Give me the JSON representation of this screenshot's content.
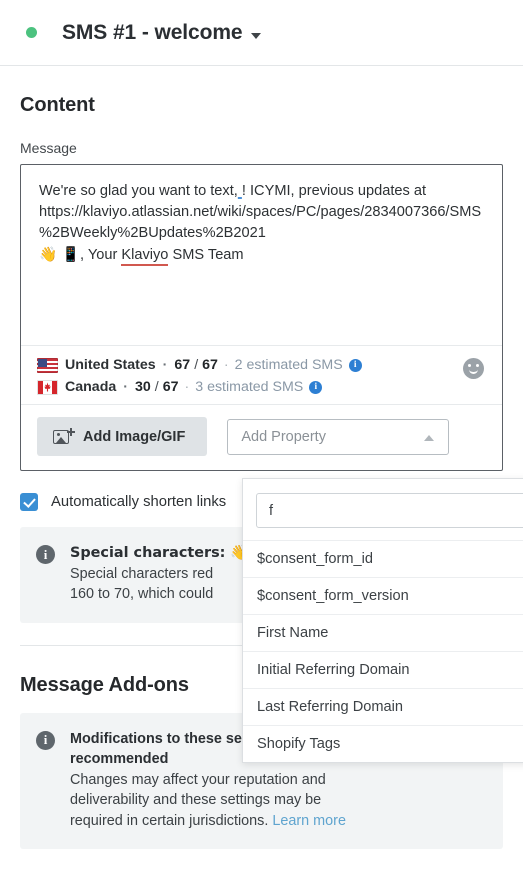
{
  "header": {
    "status_dot_color": "#4cc27f",
    "title": "SMS #1 - welcome",
    "caret_icon": "chevron-down-icon"
  },
  "content": {
    "section_title": "Content",
    "message_label": "Message",
    "message_parts": {
      "line1_a": "We're so glad you want to text,",
      "line1_err": " ",
      "line1_b": "! ICYMI, previous updates at",
      "line2": "https://klaviyo.atlassian.net/wiki/spaces/PC/pages/2834007366/SMS%2BWeekly%2BUpdates%2B2021",
      "line3_emoji": "👋 📱",
      "line3_a": ", Your ",
      "line3_sp": "Klaviyo",
      "line3_b": " SMS Team"
    },
    "counters": [
      {
        "country": "United States",
        "flag": "us-flag-icon",
        "used": "67",
        "slash": "/",
        "limit": "67",
        "estimate": "2 estimated SMS",
        "info_icon": "info-icon"
      },
      {
        "country": "Canada",
        "flag": "ca-flag-icon",
        "used": "30",
        "slash": "/",
        "limit": "67",
        "estimate": "3 estimated SMS",
        "info_icon": "info-icon"
      }
    ],
    "emoji_button_icon": "smiley-icon",
    "add_image_label": "Add Image/GIF",
    "add_image_icon": "image-plus-icon",
    "add_property_placeholder": "Add Property",
    "add_property_caret_icon": "chevron-up-icon",
    "shorten_links_label": "Automatically shorten links",
    "shorten_links_checked": true,
    "special_chars": {
      "icon": "info-icon",
      "title": "Special characters: 👋",
      "body_line1": "Special characters red",
      "body_line2": "160 to 70, which could"
    }
  },
  "dropdown": {
    "search_value": "f",
    "search_placeholder": "",
    "items": [
      "$consent_form_id",
      "$consent_form_version",
      "First Name",
      "Initial Referring Domain",
      "Last Referring Domain",
      "Shopify Tags"
    ]
  },
  "addons": {
    "section_title": "Message Add-ons",
    "notice": {
      "icon": "info-icon",
      "title_line1": "Modifications to these settings are not",
      "title_line2": "recommended",
      "body_line1": "Changes may affect your reputation and",
      "body_line2": "deliverability and these settings may be",
      "body_line3": "required in certain jurisdictions. ",
      "link_label": "Learn more",
      "collapse_icon": "chevron-up-icon"
    }
  },
  "colors": {
    "status_green": "#4cc27f",
    "checkbox_blue": "#3a8fd4",
    "info_blue": "#2d7fd3",
    "link_blue": "#5fa4cf",
    "spell_red": "#d1584f"
  }
}
